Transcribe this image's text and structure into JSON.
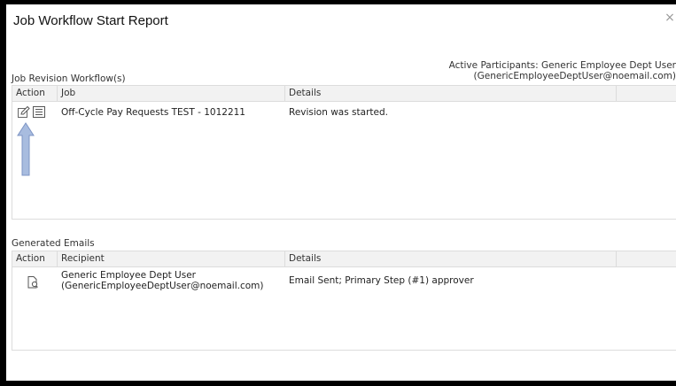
{
  "dialog": {
    "title": "Job Workflow Start Report",
    "close_glyph": "×",
    "participants_line1": "Active Participants: Generic Employee Dept User",
    "participants_line2": "(GenericEmployeeDeptUser@noemail.com)"
  },
  "workflows": {
    "section_label": "Job Revision Workflow(s)",
    "headers": {
      "action": "Action",
      "job": "Job",
      "details": "Details"
    },
    "rows": [
      {
        "job": "Off-Cycle Pay Requests TEST - 1012211",
        "details": "Revision was started.",
        "icons": [
          "edit-icon",
          "list-icon"
        ]
      }
    ]
  },
  "emails": {
    "section_label": "Generated Emails",
    "headers": {
      "action": "Action",
      "recipient": "Recipient",
      "details": "Details"
    },
    "rows": [
      {
        "recipient_line1": "Generic Employee Dept User",
        "recipient_line2": "(GenericEmployeeDeptUser@noemail.com)",
        "details": "Email Sent; Primary Step (#1) approver",
        "icon": "document-view-icon"
      }
    ]
  },
  "colors": {
    "arrow": "#9fb3d9",
    "header_bg": "#f2f2f2",
    "border": "#dcdcdc"
  }
}
